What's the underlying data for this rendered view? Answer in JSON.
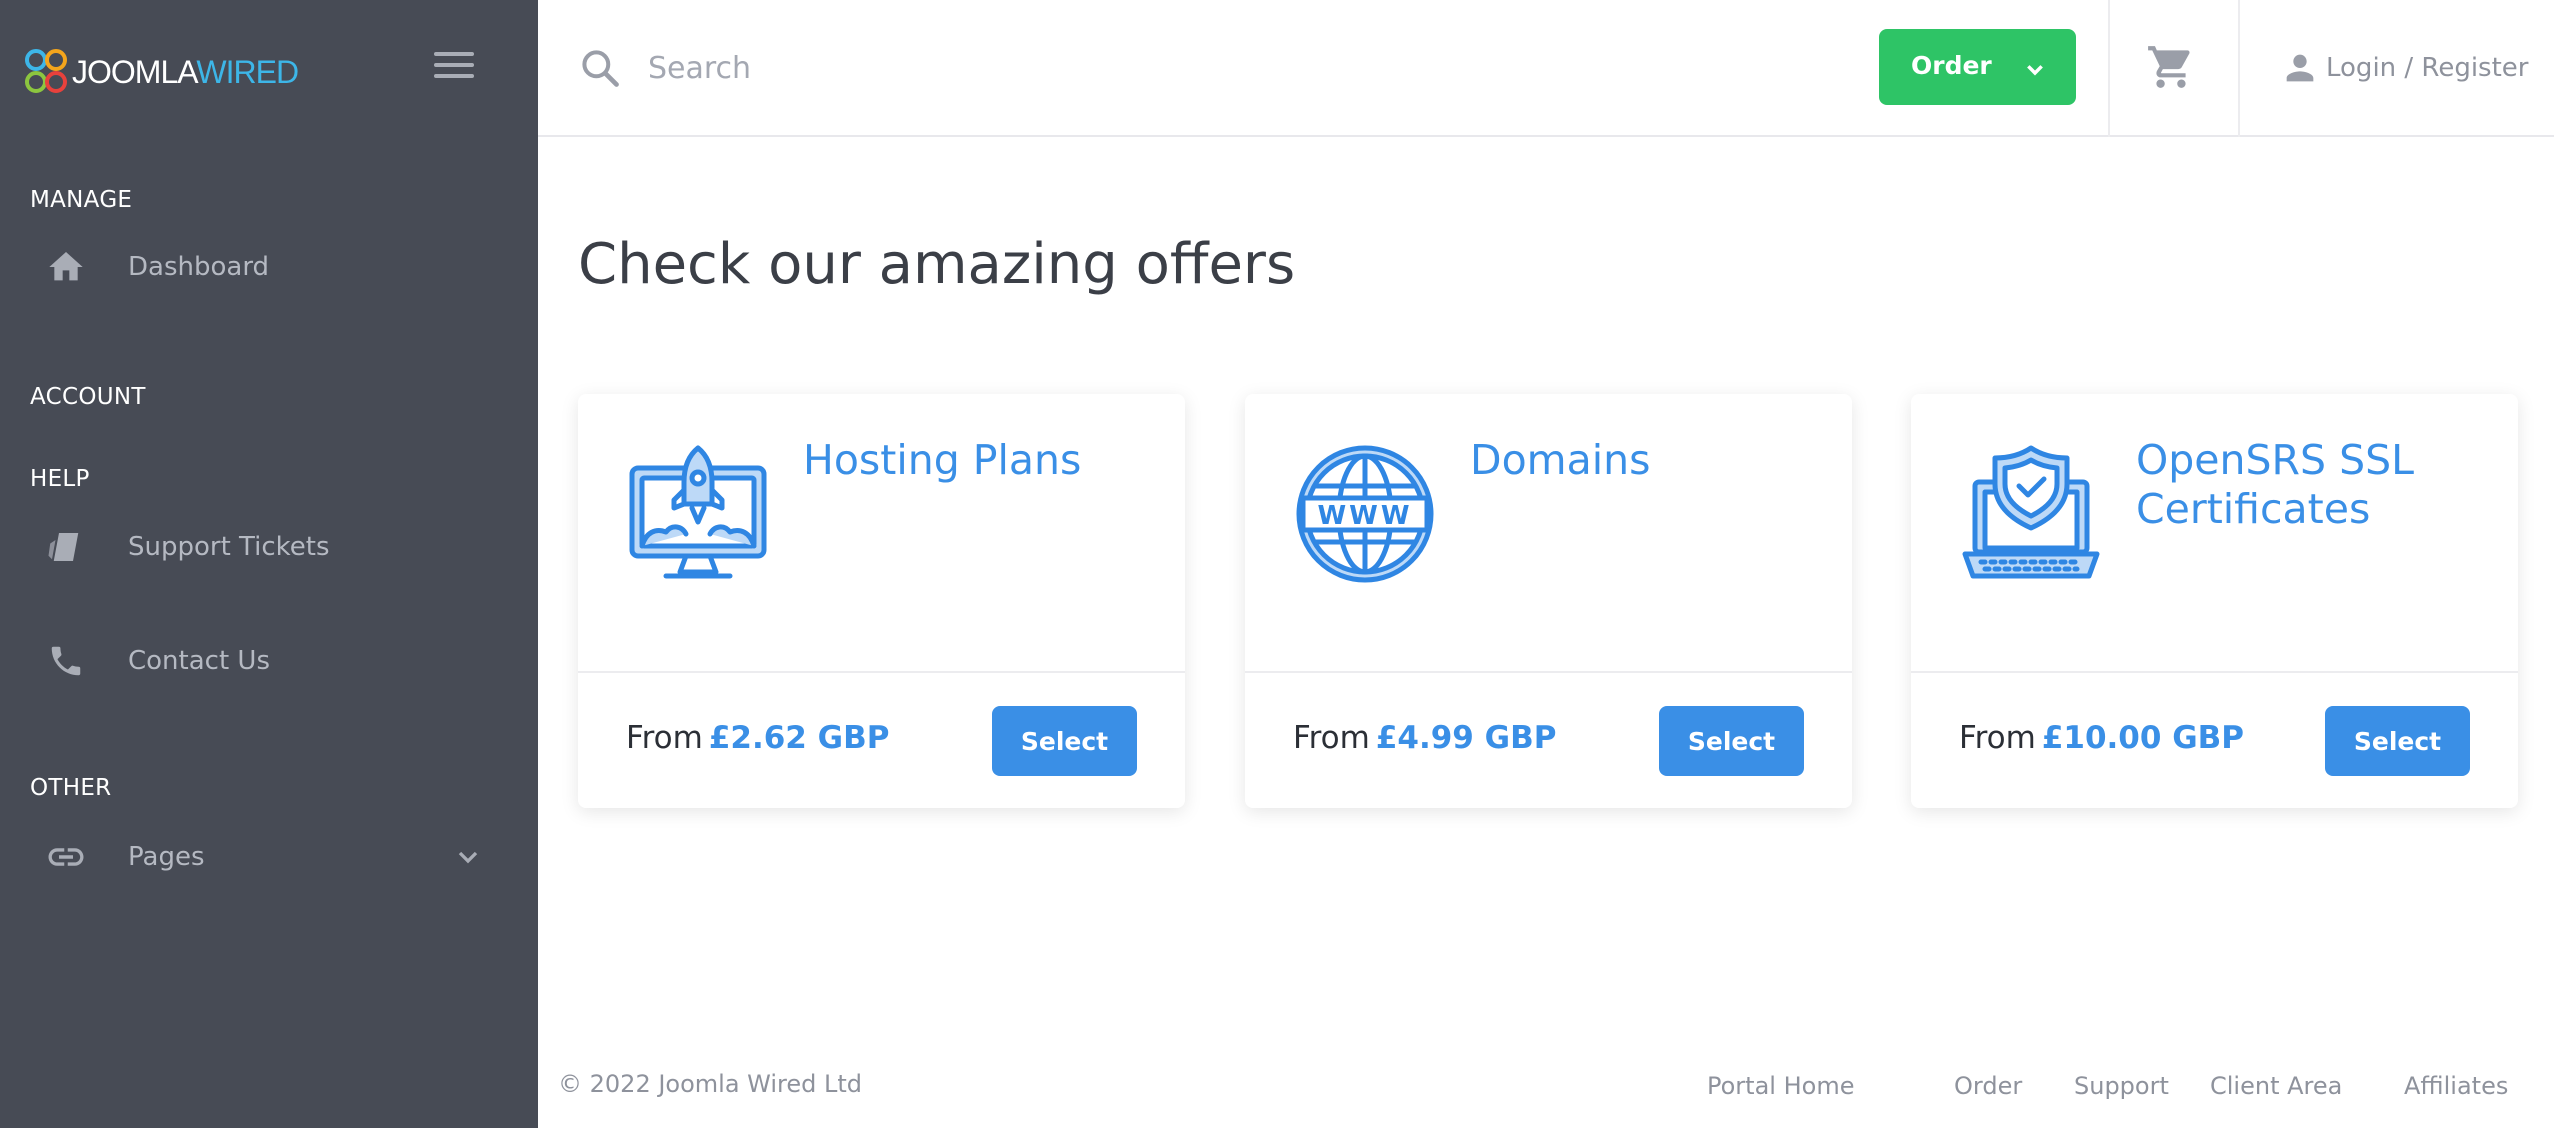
{
  "brand": {
    "logo_word1": "JOOMLA",
    "logo_word2": "WIRED"
  },
  "sidebar": {
    "sections": [
      {
        "label": "MANAGE"
      },
      {
        "label": "ACCOUNT"
      },
      {
        "label": "HELP"
      },
      {
        "label": "OTHER"
      }
    ],
    "items": [
      {
        "label": "Dashboard",
        "icon": "home-icon"
      },
      {
        "label": "Support Tickets",
        "icon": "tickets-icon"
      },
      {
        "label": "Contact Us",
        "icon": "phone-icon"
      },
      {
        "label": "Pages",
        "icon": "link-icon"
      }
    ]
  },
  "header": {
    "search_placeholder": "Search",
    "order_label": "Order",
    "user_label": "Login / Register"
  },
  "main": {
    "title": "Check our amazing offers",
    "cards": [
      {
        "title": "Hosting Plans",
        "price_prefix": "From",
        "price": "£2.62 GBP",
        "button": "Select",
        "icon": "hosting-rocket-monitor-icon"
      },
      {
        "title": "Domains",
        "price_prefix": "From",
        "price": "£4.99 GBP",
        "button": "Select",
        "icon": "www-globe-icon"
      },
      {
        "title": "OpenSRS SSL Certificates",
        "price_prefix": "From",
        "price": "£10.00 GBP",
        "button": "Select",
        "icon": "ssl-shield-laptop-icon"
      }
    ]
  },
  "footer": {
    "copyright": "© 2022 Joomla Wired Ltd",
    "links": [
      "Portal Home",
      "Order",
      "Support",
      "Client Area",
      "Affiliates"
    ]
  },
  "colors": {
    "sidebar_bg": "#474b55",
    "accent_blue": "#3a8fe6",
    "order_green": "#2ec466"
  }
}
